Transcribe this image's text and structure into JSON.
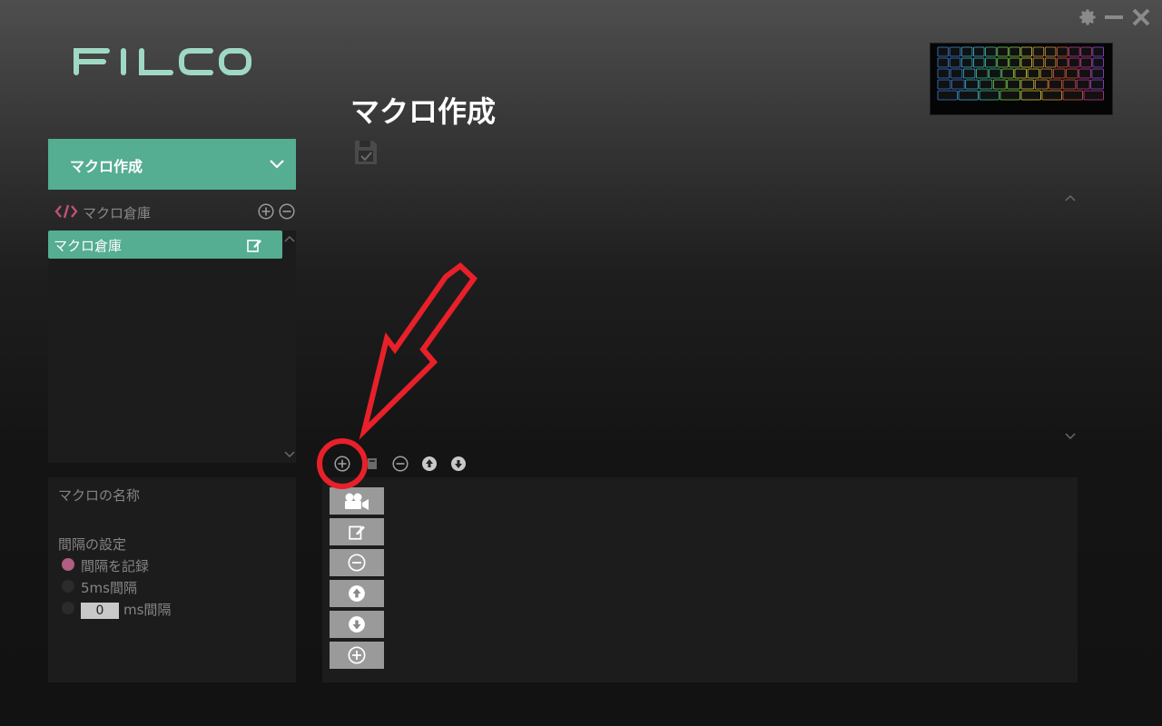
{
  "app": {
    "logo_text": "FILCO"
  },
  "window": {
    "controls": [
      "gear-icon",
      "minimize-icon",
      "close-icon"
    ]
  },
  "page": {
    "title": "マクロ作成"
  },
  "sidebar": {
    "dropdown_label": "マクロ作成",
    "warehouse_label": "マクロ倉庫",
    "macros": [
      {
        "label": "マクロ倉庫"
      }
    ]
  },
  "settings": {
    "macro_name_label": "マクロの名称",
    "interval_label": "間隔の設定",
    "options": [
      {
        "label": "間隔を記録",
        "selected": true
      },
      {
        "label": "5ms間隔",
        "selected": false
      },
      {
        "label": "ms間隔",
        "selected": false,
        "value": "0"
      }
    ]
  },
  "toolbar": {
    "icons": [
      "plus-circle-icon",
      "copy-icon",
      "minus-circle-icon",
      "arrow-up-circle-icon",
      "arrow-down-circle-icon"
    ]
  },
  "actions": {
    "icons": [
      "record-camera-icon",
      "edit-icon",
      "minus-circle-icon",
      "arrow-up-circle-icon",
      "arrow-down-circle-icon",
      "plus-circle-icon"
    ]
  },
  "colors": {
    "accent": "#55ad92",
    "logo": "#9fd9c4",
    "radio_on": "#b05e84",
    "annotation": "#e8202a"
  }
}
